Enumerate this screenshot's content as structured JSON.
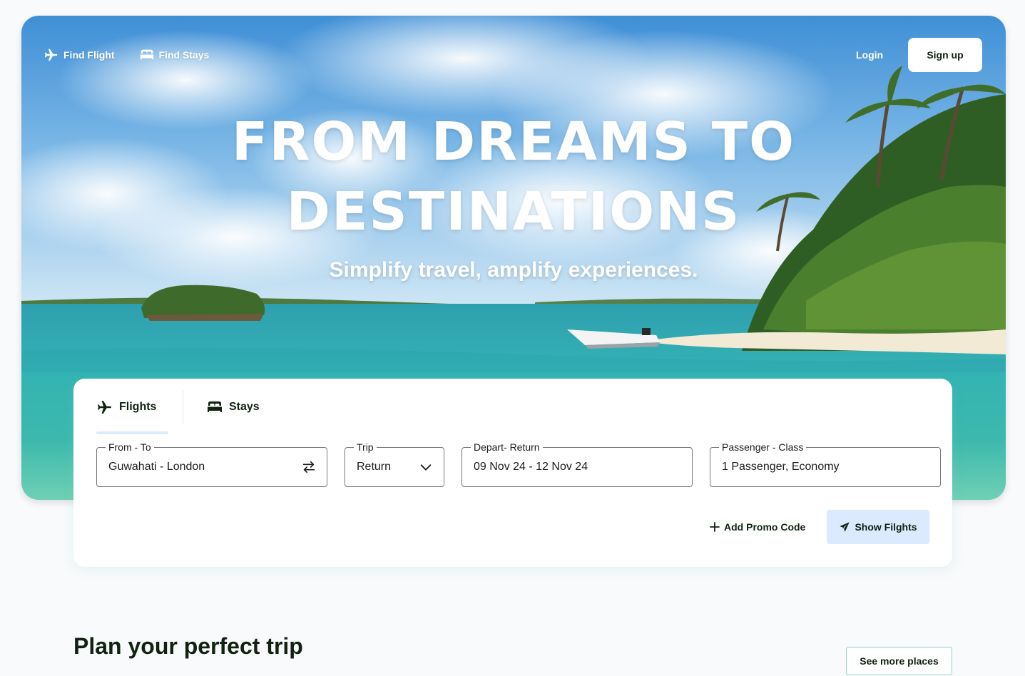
{
  "nav": {
    "find_flight": "Find Flight",
    "find_stays": "Find Stays",
    "login": "Login",
    "signup": "Sign up"
  },
  "hero": {
    "title_line1": "FROM DREAMS TO",
    "title_line2": "DESTINATIONS",
    "subtitle": "Simplify travel, amplify experiences."
  },
  "search": {
    "tabs": [
      {
        "label": "Flights",
        "icon": "airplane-icon",
        "active": true
      },
      {
        "label": "Stays",
        "icon": "bed-icon",
        "active": false
      }
    ],
    "fields": {
      "from_to": {
        "label": "From - To",
        "value": "Guwahati - London"
      },
      "trip": {
        "label": "Trip",
        "value": "Return"
      },
      "dates": {
        "label": "Depart- Return",
        "value": "09 Nov 24 - 12 Nov 24"
      },
      "passenger": {
        "label": "Passenger - Class",
        "value": "1 Passenger, Economy"
      }
    },
    "add_promo": "Add Promo Code",
    "show_flights": "Show Filghts"
  },
  "section": {
    "title": "Plan your perfect trip",
    "see_more": "See more places"
  },
  "colors": {
    "accent_light_blue": "#dbeafe",
    "mint_border": "#8dd3bb",
    "text_dark": "#112211"
  }
}
